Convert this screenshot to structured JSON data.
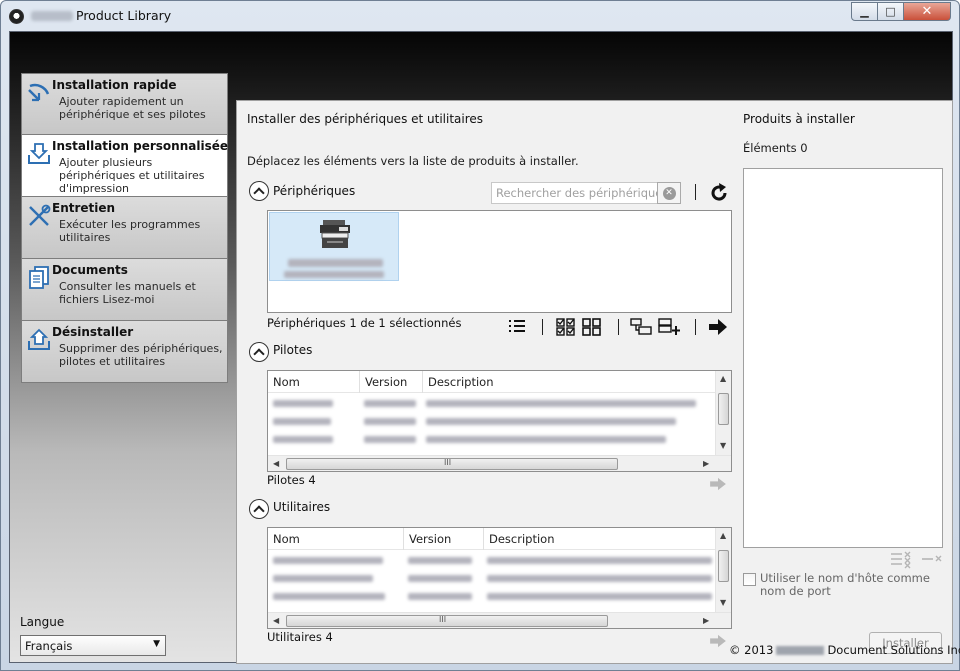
{
  "window": {
    "title": "Product Library",
    "minimize_glyph": "▁",
    "maximize_glyph": "□",
    "close_glyph": "✕"
  },
  "sidebar": {
    "items": [
      {
        "title": "Installation rapide",
        "desc": "Ajouter rapidement un périphérique et ses pilotes",
        "icon": "quick-install-icon",
        "active": false
      },
      {
        "title": "Installation personnalisée",
        "desc": "Ajouter plusieurs périphériques et utilitaires d'impression",
        "icon": "custom-install-icon",
        "active": true
      },
      {
        "title": "Entretien",
        "desc": "Exécuter les programmes utilitaires",
        "icon": "maintenance-tools-icon",
        "active": false
      },
      {
        "title": "Documents",
        "desc": "Consulter les manuels et fichiers Lisez-moi",
        "icon": "documents-icon",
        "active": false
      },
      {
        "title": "Désinstaller",
        "desc": "Supprimer des périphériques, pilotes et utilitaires",
        "icon": "uninstall-icon",
        "active": false
      }
    ],
    "language_label": "Langue",
    "language_value": "Français"
  },
  "main": {
    "header": "Installer des périphériques et utilitaires",
    "instruction": "Déplacez les éléments vers la liste de produits à installer.",
    "devices": {
      "title": "Périphériques",
      "search_placeholder": "Rechercher des périphériques",
      "status": "Périphériques 1 de 1 sélectionnés"
    },
    "drivers": {
      "title": "Pilotes",
      "columns": [
        "Nom",
        "Version",
        "Description"
      ],
      "count_label": "Pilotes 4"
    },
    "utilities": {
      "title": "Utilitaires",
      "columns": [
        "Nom",
        "Version",
        "Description"
      ],
      "count_label": "Utilitaires 4"
    },
    "scroll_grip": "III"
  },
  "products": {
    "title": "Produits à installer",
    "elements_label": "Éléments 0",
    "hostname_label": "Utiliser le nom d'hôte comme nom de port",
    "install_button": "Installer"
  },
  "footer": {
    "copyright_prefix": "© 2013",
    "copyright_suffix": "Document Solutions Inc."
  },
  "colors": {
    "selected_tile": "#d6e9f8",
    "panel_bg": "#f1f1f1",
    "close_button": "#c9503a"
  }
}
